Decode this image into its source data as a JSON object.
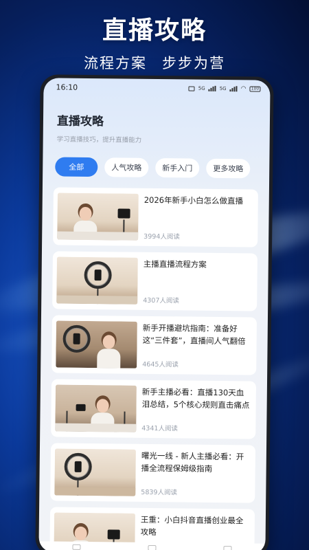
{
  "banner": {
    "title": "直播攻略",
    "subtitle_left": "流程方案",
    "subtitle_right": "步步为营"
  },
  "status_bar": {
    "time": "16:10",
    "network_1": "5G",
    "network_2": "5G",
    "battery": "100"
  },
  "header": {
    "title": "直播攻略",
    "subtitle": "学习直播技巧，提升直播能力"
  },
  "tabs": [
    {
      "label": "全部",
      "active": true
    },
    {
      "label": "人气攻略",
      "active": false
    },
    {
      "label": "新手入门",
      "active": false
    },
    {
      "label": "更多攻略",
      "active": false
    }
  ],
  "articles": [
    {
      "title": "2026年新手小白怎么做直播",
      "reads": "3994人阅读"
    },
    {
      "title": "主播直播流程方案",
      "reads": "4307人阅读"
    },
    {
      "title": "新手开播避坑指南：准备好这“三件套”，直播间人气翻倍",
      "reads": "4645人阅读"
    },
    {
      "title": "新手主播必看：直播130天血泪总结，5个核心规则直击痛点",
      "reads": "4341人阅读"
    },
    {
      "title": "曙光一线 - 新人主播必看：开播全流程保姆级指南",
      "reads": "5839人阅读"
    },
    {
      "title": "王重：小白抖音直播创业最全攻略",
      "reads": ""
    }
  ],
  "colors": {
    "accent": "#2f7cf0",
    "background": "#0b3a9c"
  }
}
